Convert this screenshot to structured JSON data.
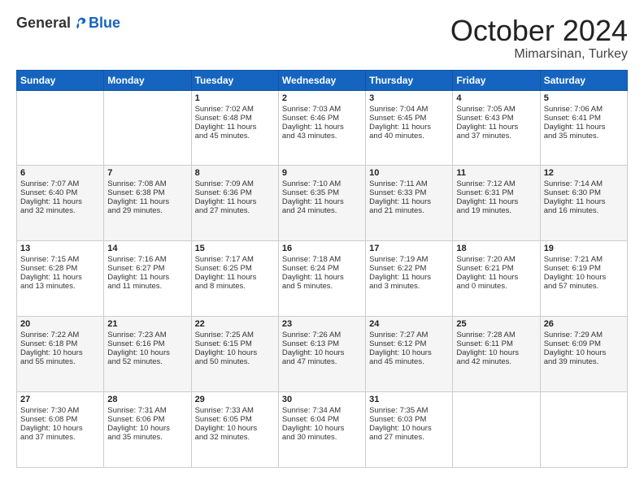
{
  "header": {
    "logo_general": "General",
    "logo_blue": "Blue",
    "month": "October 2024",
    "location": "Mimarsinan, Turkey"
  },
  "weekdays": [
    "Sunday",
    "Monday",
    "Tuesday",
    "Wednesday",
    "Thursday",
    "Friday",
    "Saturday"
  ],
  "weeks": [
    [
      {
        "day": "",
        "content": ""
      },
      {
        "day": "",
        "content": ""
      },
      {
        "day": "1",
        "content": "Sunrise: 7:02 AM\nSunset: 6:48 PM\nDaylight: 11 hours and 45 minutes."
      },
      {
        "day": "2",
        "content": "Sunrise: 7:03 AM\nSunset: 6:46 PM\nDaylight: 11 hours and 43 minutes."
      },
      {
        "day": "3",
        "content": "Sunrise: 7:04 AM\nSunset: 6:45 PM\nDaylight: 11 hours and 40 minutes."
      },
      {
        "day": "4",
        "content": "Sunrise: 7:05 AM\nSunset: 6:43 PM\nDaylight: 11 hours and 37 minutes."
      },
      {
        "day": "5",
        "content": "Sunrise: 7:06 AM\nSunset: 6:41 PM\nDaylight: 11 hours and 35 minutes."
      }
    ],
    [
      {
        "day": "6",
        "content": "Sunrise: 7:07 AM\nSunset: 6:40 PM\nDaylight: 11 hours and 32 minutes."
      },
      {
        "day": "7",
        "content": "Sunrise: 7:08 AM\nSunset: 6:38 PM\nDaylight: 11 hours and 29 minutes."
      },
      {
        "day": "8",
        "content": "Sunrise: 7:09 AM\nSunset: 6:36 PM\nDaylight: 11 hours and 27 minutes."
      },
      {
        "day": "9",
        "content": "Sunrise: 7:10 AM\nSunset: 6:35 PM\nDaylight: 11 hours and 24 minutes."
      },
      {
        "day": "10",
        "content": "Sunrise: 7:11 AM\nSunset: 6:33 PM\nDaylight: 11 hours and 21 minutes."
      },
      {
        "day": "11",
        "content": "Sunrise: 7:12 AM\nSunset: 6:31 PM\nDaylight: 11 hours and 19 minutes."
      },
      {
        "day": "12",
        "content": "Sunrise: 7:14 AM\nSunset: 6:30 PM\nDaylight: 11 hours and 16 minutes."
      }
    ],
    [
      {
        "day": "13",
        "content": "Sunrise: 7:15 AM\nSunset: 6:28 PM\nDaylight: 11 hours and 13 minutes."
      },
      {
        "day": "14",
        "content": "Sunrise: 7:16 AM\nSunset: 6:27 PM\nDaylight: 11 hours and 11 minutes."
      },
      {
        "day": "15",
        "content": "Sunrise: 7:17 AM\nSunset: 6:25 PM\nDaylight: 11 hours and 8 minutes."
      },
      {
        "day": "16",
        "content": "Sunrise: 7:18 AM\nSunset: 6:24 PM\nDaylight: 11 hours and 5 minutes."
      },
      {
        "day": "17",
        "content": "Sunrise: 7:19 AM\nSunset: 6:22 PM\nDaylight: 11 hours and 3 minutes."
      },
      {
        "day": "18",
        "content": "Sunrise: 7:20 AM\nSunset: 6:21 PM\nDaylight: 11 hours and 0 minutes."
      },
      {
        "day": "19",
        "content": "Sunrise: 7:21 AM\nSunset: 6:19 PM\nDaylight: 10 hours and 57 minutes."
      }
    ],
    [
      {
        "day": "20",
        "content": "Sunrise: 7:22 AM\nSunset: 6:18 PM\nDaylight: 10 hours and 55 minutes."
      },
      {
        "day": "21",
        "content": "Sunrise: 7:23 AM\nSunset: 6:16 PM\nDaylight: 10 hours and 52 minutes."
      },
      {
        "day": "22",
        "content": "Sunrise: 7:25 AM\nSunset: 6:15 PM\nDaylight: 10 hours and 50 minutes."
      },
      {
        "day": "23",
        "content": "Sunrise: 7:26 AM\nSunset: 6:13 PM\nDaylight: 10 hours and 47 minutes."
      },
      {
        "day": "24",
        "content": "Sunrise: 7:27 AM\nSunset: 6:12 PM\nDaylight: 10 hours and 45 minutes."
      },
      {
        "day": "25",
        "content": "Sunrise: 7:28 AM\nSunset: 6:11 PM\nDaylight: 10 hours and 42 minutes."
      },
      {
        "day": "26",
        "content": "Sunrise: 7:29 AM\nSunset: 6:09 PM\nDaylight: 10 hours and 39 minutes."
      }
    ],
    [
      {
        "day": "27",
        "content": "Sunrise: 7:30 AM\nSunset: 6:08 PM\nDaylight: 10 hours and 37 minutes."
      },
      {
        "day": "28",
        "content": "Sunrise: 7:31 AM\nSunset: 6:06 PM\nDaylight: 10 hours and 35 minutes."
      },
      {
        "day": "29",
        "content": "Sunrise: 7:33 AM\nSunset: 6:05 PM\nDaylight: 10 hours and 32 minutes."
      },
      {
        "day": "30",
        "content": "Sunrise: 7:34 AM\nSunset: 6:04 PM\nDaylight: 10 hours and 30 minutes."
      },
      {
        "day": "31",
        "content": "Sunrise: 7:35 AM\nSunset: 6:03 PM\nDaylight: 10 hours and 27 minutes."
      },
      {
        "day": "",
        "content": ""
      },
      {
        "day": "",
        "content": ""
      }
    ]
  ]
}
